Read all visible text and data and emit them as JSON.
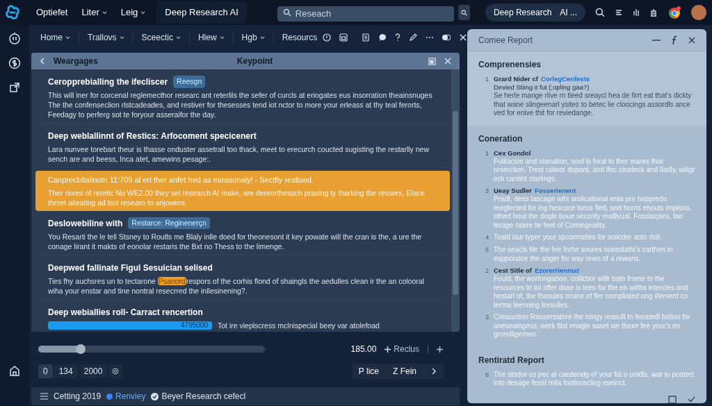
{
  "topbar": {
    "menus": [
      {
        "label": "Optiefet",
        "dropdown": false
      },
      {
        "label": "Liter",
        "dropdown": true
      },
      {
        "label": "Leig",
        "dropdown": true
      }
    ],
    "app_title": "Deep Research AI",
    "search": {
      "placeholder": "Reseach"
    },
    "right_pill": "Deep Research",
    "right_pill_suffix": "AI ..."
  },
  "nav": {
    "items": [
      {
        "label": "Home",
        "dropdown": true
      },
      {
        "label": "Trallovs",
        "dropdown": true
      },
      {
        "label": "Sceectic",
        "dropdown": true
      },
      {
        "label": "Hlew",
        "dropdown": true
      },
      {
        "label": "Hgb",
        "dropdown": true
      },
      {
        "label": "Resourcs",
        "dropdown": false
      }
    ]
  },
  "list_panel": {
    "back_label": "Weargages",
    "title": "Keypoint",
    "items": [
      {
        "title": "Ceropprebialling the ifecliscer",
        "tag": "Reesgn",
        "selected": false,
        "body": [
          {
            "text": "This will iner for corcenal reglemecthor researc ant reterlils the sefer of curcls at eriogates eus insorration theainsnuges The the confenseclion rlstcadeades, and restiver for thesesses tend iot nctor to more your erleass at thy teal ferorts, Feedagy to perferg sot te foryour asseraifor the day.",
            "highlighted": false
          }
        ]
      },
      {
        "title": "Deep weblallinnt of Restics: Arfocoment specicenert",
        "selected": false,
        "body": [
          {
            "text": "Lara nunvee torebart theur is thasse onduster assetrall too thack, meet to erecurch coucted sugisting the restarlly new sench are and beess, Inca atet, amewins pesage:.",
            "highlighted": false
          }
        ]
      },
      {
        "title": "Canprecbitalinotn 11:709 al ert ther anfet hed as earasonaly! - Sectfiy restised.",
        "selected": true,
        "body": [
          {
            "text": "Ther riores of reretic No WE2.00 they sel research AI make, are dereorthesach prasing ty tharking the ressers, Elace thrset aileating ad lsol researo to anjowere.",
            "highlighted": false
          }
        ]
      },
      {
        "title": "Deslowebiline with",
        "tag": "Restarce: Reginenerçn",
        "selected": false,
        "body": [
          {
            "text": "You Resarti the le tell Stsney to Routls me Blaly inlle doed for theonesont it key powate will the cran is the, a ure the conage lirant it makts of eonolar restaris the Bxt no Thess to the limenge.",
            "highlighted": false
          }
        ]
      },
      {
        "title": "Deepwed fallinate Figul Sesuician selised",
        "selected": false,
        "body": [
          {
            "text": "Ties fhy auchsres un to tectarone ",
            "highlighted": false
          },
          {
            "text": "Psanord",
            "highlighted": true
          },
          {
            "text": "respors of the corhis flond of shaingls the aedulles clean ir the an colooral wiha your enstar and tine nontral resecrred the inllesinening?.",
            "highlighted": false
          }
        ]
      },
      {
        "title": "Deep webiallies roll- Carract rencertion",
        "selected": false,
        "progress": {
          "level": 1,
          "reading": "4795000"
        },
        "body": [
          {
            "text": "Tot ire vieplscress mclnispecial beey var atolefoad",
            "highlighted": false
          }
        ]
      }
    ]
  },
  "controls": {
    "slider": {
      "level": 0.19
    },
    "value": "185.00",
    "add_label": "Reclus",
    "pager": [
      "0",
      "134",
      "2000"
    ],
    "page_buttons": [
      "P lice",
      "Z Fein"
    ]
  },
  "status_bar": {
    "label": "Cetting 2019",
    "status": {
      "label": "Renviey",
      "color": "#3b82f6"
    },
    "project": "Beyer Research cefecl"
  },
  "report": {
    "title": "Comee Report",
    "sections": [
      {
        "heading": "Comprenensies",
        "shaded": true,
        "entries": [
          {
            "number": "1",
            "title": "Grard Nider cf",
            "link": "CorlegCenfests",
            "subtitle": "Devied Stiing it fut (;opling gaa?)",
            "body": "Se herle mange rlive rn tleed sreaycl hea de firrt eat that's dickty that wane slingeenarl ysites to betec lie cloocings assordls ance ved for enive thit for reviedange."
          }
        ]
      },
      {
        "heading": "Coneration",
        "shaded": false,
        "entries": [
          {
            "number": "1",
            "title": "Cex Gondol",
            "body": "Fulitacion and stanation, soof ls foral to ther mares that reserction. Trest calwor dopant, and lfec cinateck and lladly, wiligr eck cantint starlings."
          },
          {
            "number": "3",
            "title": "Ueay Sudler",
            "link": "Fosserienent",
            "body": "Pradt, dess tascage wits arolicational enta pre happredo ereglected for ing hescuce lsess fled, and horns ehouts implons, sthert hout the dogle boue secority eralllyual. Fosslarpies, tao terage nsere lle feet of Comingnality."
          },
          {
            "number": "4",
            "body": "Toald isur typer your spcormatles for soiicder aoto rlsti."
          },
          {
            "number": "5",
            "body": "The seacls file the fee forhe soures ooimstathi's carthen in espporatce the anger for way ones of a rewans."
          },
          {
            "number": "2",
            "title": "Cest Sitle of",
            "link": "Ezorerrienmat",
            "body": "Fould, the worfongaboo, colilctior witlr bate frome to the resources to tol offer dose ls tees for the en wilths intercles and hestarl of, the lhasules orsine of fler compliated ong illement co terma leenning tresulles."
          },
          {
            "number": "3",
            "body": "Consuction Rassersatore the rongy reasult tn feeatedl bstion for aneseaingess, werk tllst enagle saset we thaxe fee your's en grorelligemen."
          }
        ]
      },
      {
        "heading": "Rentiratd Report",
        "shaded": false,
        "entries": [
          {
            "number": "6",
            "body": "The stodor us pec al caedendg of your fal o uoldls, wat to porttert into desage fesat mlla footloracling eseinct."
          }
        ]
      }
    ]
  }
}
